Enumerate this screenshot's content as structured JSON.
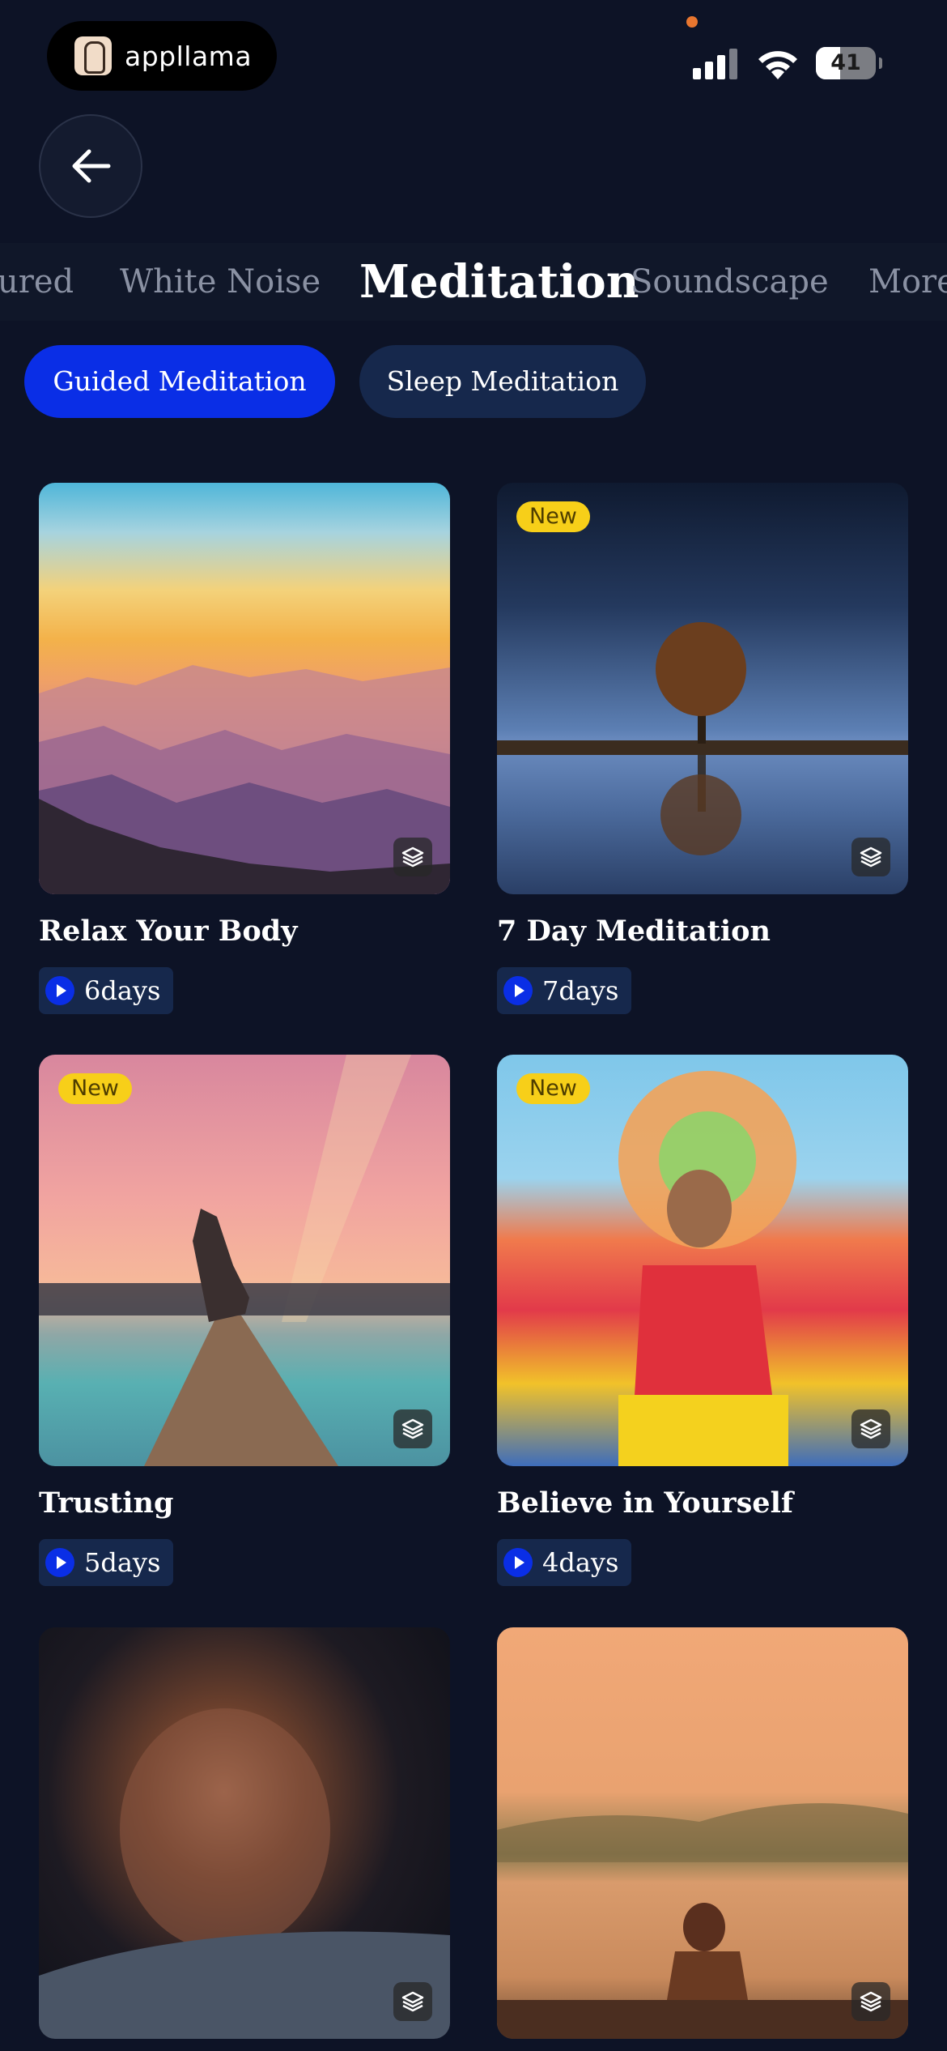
{
  "status_bar": {
    "brand_name": "appllama",
    "battery_level": 41,
    "battery_text": "41"
  },
  "tabs": [
    "ured",
    "White Noise",
    "Meditation",
    "Soundscape",
    "More"
  ],
  "active_tab": "Meditation",
  "chips": {
    "guided": "Guided Meditation",
    "sleep": "Sleep Meditation"
  },
  "cards": [
    {
      "title": "Relax Your Body",
      "duration": "6days",
      "badge": ""
    },
    {
      "title": "7 Day Meditation",
      "duration": "7days",
      "badge": "New"
    },
    {
      "title": "Trusting",
      "duration": "5days",
      "badge": "New"
    },
    {
      "title": "Believe in Yourself",
      "duration": "4days",
      "badge": "New"
    },
    {
      "title": "",
      "duration": "",
      "badge": ""
    },
    {
      "title": "",
      "duration": "",
      "badge": ""
    }
  ],
  "colors": {
    "background": "#0d1326",
    "accent": "#0a2ee6",
    "chip_inactive": "#16284c",
    "badge": "#f7cf19"
  },
  "icons": {
    "back": "arrow-left-icon",
    "stack": "layers-icon",
    "play": "play-icon"
  }
}
